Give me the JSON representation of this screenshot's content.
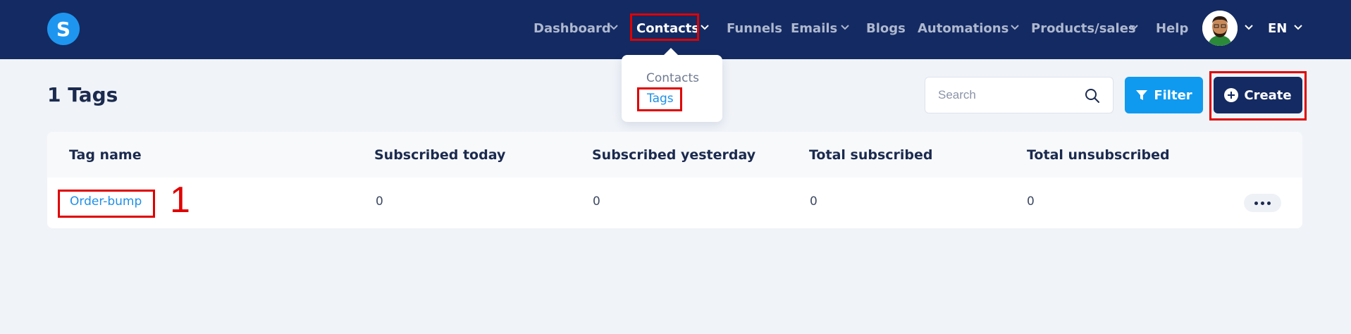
{
  "nav": {
    "logo_letter": "S",
    "items": [
      {
        "label": "Dashboard"
      },
      {
        "label": "Contacts"
      },
      {
        "label": "Funnels"
      },
      {
        "label": "Emails"
      },
      {
        "label": "Blogs"
      },
      {
        "label": "Automations"
      },
      {
        "label": "Products/sales"
      },
      {
        "label": "Help"
      }
    ],
    "language": "EN"
  },
  "dropdown": {
    "items": [
      {
        "label": "Contacts"
      },
      {
        "label": "Tags"
      }
    ]
  },
  "page": {
    "title": "1 Tags",
    "search_placeholder": "Search",
    "filter_label": "Filter",
    "create_label": "Create"
  },
  "table": {
    "headers": [
      "Tag name",
      "Subscribed today",
      "Subscribed yesterday",
      "Total subscribed",
      "Total unsubscribed"
    ],
    "rows": [
      {
        "tag_name": "Order-bump",
        "subscribed_today": "0",
        "subscribed_yesterday": "0",
        "total_subscribed": "0",
        "total_unsubscribed": "0"
      }
    ]
  },
  "annotation": {
    "number": "1"
  },
  "colors": {
    "nav_bg": "#142a62",
    "accent": "#0f9af0",
    "highlight": "#e00000"
  }
}
